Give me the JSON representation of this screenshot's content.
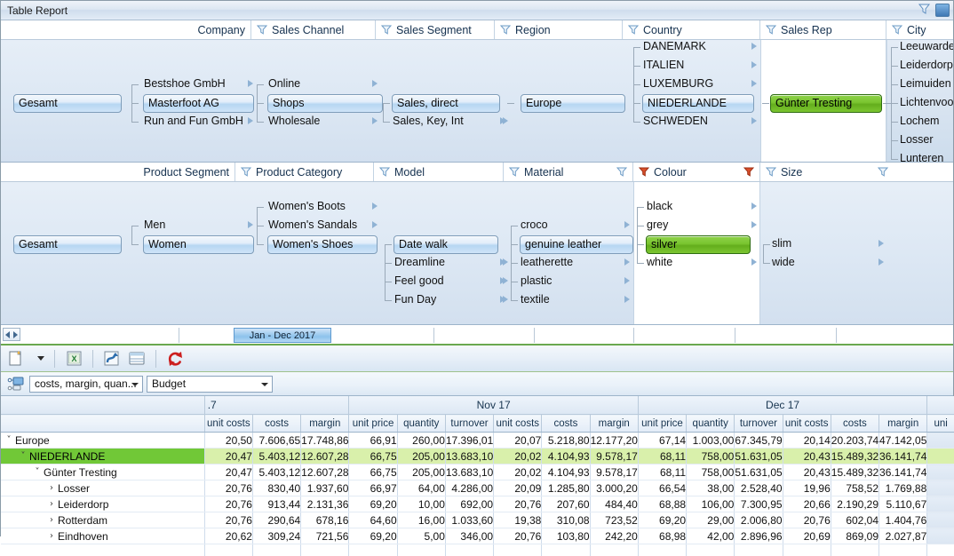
{
  "window": {
    "title": "Table Report"
  },
  "filter_panel_1": {
    "columns": [
      {
        "label": "Company",
        "has_filter": false,
        "filter_active": false
      },
      {
        "label": "Sales Channel",
        "has_filter": true,
        "filter_active": false
      },
      {
        "label": "Sales Segment",
        "has_filter": true,
        "filter_active": false
      },
      {
        "label": "Region",
        "has_filter": true,
        "filter_active": false
      },
      {
        "label": "Country",
        "has_filter": true,
        "filter_active": false
      },
      {
        "label": "Sales Rep",
        "has_filter": true,
        "filter_active": false
      },
      {
        "label": "City",
        "has_filter": true,
        "filter_active": false
      }
    ],
    "total_node": "Gesamt",
    "company": [
      "Bestshoe GmbH",
      "Masterfoot AG",
      "Run and Fun GmbH"
    ],
    "company_selected": "Masterfoot AG",
    "sales_channel": [
      "Online",
      "Shops",
      "Wholesale"
    ],
    "sales_channel_selected": "Shops",
    "sales_segment": [
      "Sales, direct",
      "Sales, Key, Int"
    ],
    "sales_segment_selected": "Sales, direct",
    "region": [
      "Europe"
    ],
    "region_selected": "Europe",
    "country": [
      "DANEMARK",
      "ITALIEN",
      "LUXEMBURG",
      "NIEDERLANDE",
      "SCHWEDEN"
    ],
    "country_selected": "NIEDERLANDE",
    "sales_rep": [
      "Günter Tresting"
    ],
    "sales_rep_selected": "Günter Tresting",
    "city": [
      "Leeuwarden",
      "Leiderdorp",
      "Leimuiden",
      "Lichtenvoorde",
      "Lochem",
      "Losser",
      "Lunteren"
    ]
  },
  "filter_panel_2": {
    "columns": [
      {
        "label": "Product Segment",
        "has_filter": false,
        "filter_active": false
      },
      {
        "label": "Product Category",
        "has_filter": true,
        "filter_active": false
      },
      {
        "label": "Model",
        "has_filter": true,
        "filter_active": false
      },
      {
        "label": "Material",
        "has_filter": true,
        "filter_active": false
      },
      {
        "label": "Colour",
        "has_filter": true,
        "filter_active": true
      },
      {
        "label": "Size",
        "has_filter": true,
        "filter_active": false
      }
    ],
    "total_node": "Gesamt",
    "product_segment": [
      "Men",
      "Women"
    ],
    "product_segment_selected": "Women",
    "product_category": [
      "Women's Boots",
      "Women's Sandals",
      "Women's Shoes"
    ],
    "product_category_selected": "Women's Shoes",
    "model": [
      "Date walk",
      "Dreamline",
      "Feel good",
      "Fun Day"
    ],
    "model_selected": "Date walk",
    "material": [
      "croco",
      "genuine leather",
      "leatherette",
      "plastic",
      "textile"
    ],
    "material_selected": "genuine leather",
    "colour": [
      "black",
      "grey",
      "silver",
      "white"
    ],
    "colour_selected": "silver",
    "size": [
      "slim",
      "wide"
    ]
  },
  "period_bar": {
    "selected_period": "Jan - Dec 2017"
  },
  "toolbar": {
    "new_label": "new-document",
    "excel_label": "excel-export",
    "chart_label": "chart-view",
    "table_label": "table-view",
    "refresh_label": "refresh"
  },
  "toolbar2": {
    "measures_value": "costs, margin, quan...",
    "scenario_value": "Budget"
  },
  "grid": {
    "group_headers": [
      {
        "label": "",
        "span": 1
      },
      {
        "label": ".7",
        "span": 3
      },
      {
        "label": "Nov 17",
        "span": 6
      },
      {
        "label": "Dec 17",
        "span": 6
      },
      {
        "label": "",
        "span": 1
      }
    ],
    "columns": [
      "",
      "unit costs",
      "costs",
      "margin",
      "unit price",
      "quantity",
      "turnover",
      "unit costs",
      "costs",
      "margin",
      "unit price",
      "quantity",
      "turnover",
      "unit costs",
      "costs",
      "margin",
      "uni"
    ],
    "rows": [
      {
        "label": "Europe",
        "depth": 0,
        "twisty": "expanded",
        "highlight": false,
        "values": [
          "20,50",
          "7.606,65",
          "17.748,86",
          "66,91",
          "260,00",
          "17.396,01",
          "20,07",
          "5.218,80",
          "12.177,20",
          "67,14",
          "1.003,00",
          "67.345,79",
          "20,14",
          "20.203,74",
          "47.142,05",
          ""
        ]
      },
      {
        "label": "NIEDERLANDE",
        "depth": 1,
        "twisty": "expanded",
        "highlight": true,
        "values": [
          "20,47",
          "5.403,12",
          "12.607,28",
          "66,75",
          "205,00",
          "13.683,10",
          "20,02",
          "4.104,93",
          "9.578,17",
          "68,11",
          "758,00",
          "51.631,05",
          "20,43",
          "15.489,32",
          "36.141,74",
          ""
        ]
      },
      {
        "label": "Günter Tresting",
        "depth": 2,
        "twisty": "expanded",
        "highlight": false,
        "values": [
          "20,47",
          "5.403,12",
          "12.607,28",
          "66,75",
          "205,00",
          "13.683,10",
          "20,02",
          "4.104,93",
          "9.578,17",
          "68,11",
          "758,00",
          "51.631,05",
          "20,43",
          "15.489,32",
          "36.141,74",
          ""
        ]
      },
      {
        "label": "Losser",
        "depth": 3,
        "twisty": "collapsed",
        "highlight": false,
        "values": [
          "20,76",
          "830,40",
          "1.937,60",
          "66,97",
          "64,00",
          "4.286,00",
          "20,09",
          "1.285,80",
          "3.000,20",
          "66,54",
          "38,00",
          "2.528,40",
          "19,96",
          "758,52",
          "1.769,88",
          ""
        ]
      },
      {
        "label": "Leiderdorp",
        "depth": 3,
        "twisty": "collapsed",
        "highlight": false,
        "values": [
          "20,76",
          "913,44",
          "2.131,36",
          "69,20",
          "10,00",
          "692,00",
          "20,76",
          "207,60",
          "484,40",
          "68,88",
          "106,00",
          "7.300,95",
          "20,66",
          "2.190,29",
          "5.110,67",
          ""
        ]
      },
      {
        "label": "Rotterdam",
        "depth": 3,
        "twisty": "collapsed",
        "highlight": false,
        "values": [
          "20,76",
          "290,64",
          "678,16",
          "64,60",
          "16,00",
          "1.033,60",
          "19,38",
          "310,08",
          "723,52",
          "69,20",
          "29,00",
          "2.006,80",
          "20,76",
          "602,04",
          "1.404,76",
          ""
        ]
      },
      {
        "label": "Eindhoven",
        "depth": 3,
        "twisty": "collapsed",
        "highlight": false,
        "values": [
          "20,62",
          "309,24",
          "721,56",
          "69,20",
          "5,00",
          "346,00",
          "20,76",
          "103,80",
          "242,20",
          "68,98",
          "42,00",
          "2.896,96",
          "20,69",
          "869,09",
          "2.027,87",
          ""
        ]
      }
    ]
  },
  "colors": {
    "selection_green": "#71c837",
    "row_highlight_green": "#d9f0ab",
    "pill_blue": "#b6d6f2",
    "filter_active_red": "#c0392b",
    "refresh_red": "#cc1f1f"
  }
}
